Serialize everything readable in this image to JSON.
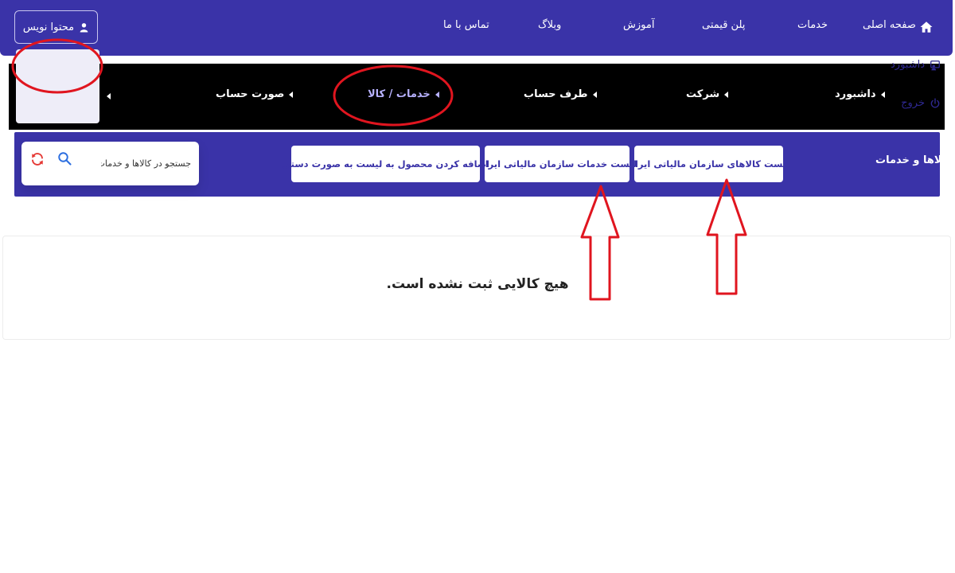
{
  "header": {
    "home_label": "صفحه اصلی",
    "nav": [
      "خدمات",
      "پلن قیمتی",
      "آموزش",
      "وبلاگ",
      "تماس با ما"
    ],
    "user_label": "محتوا نویس"
  },
  "user_menu": {
    "dashboard": "داشبورد",
    "logout": "خروج"
  },
  "tabs": [
    "داشبورد",
    "شرکت",
    "طرف حساب",
    "خدمات / کالا",
    "صورت حساب"
  ],
  "active_tab": "خدمات / کالا",
  "subbar": {
    "title": "کالاها و خدمات",
    "buttons": [
      "لیست کالاهای سازمان مالیاتی ایران",
      "لیست خدمات سازمان مالیاتی ایران",
      "اضافه کردن محصول به لیست به صورت دستی"
    ],
    "search_placeholder": "جستجو در کالاها و خدمات"
  },
  "empty_state": {
    "message": "هیچ کالایی ثبت نشده است."
  },
  "colors": {
    "primary": "#3a33a8",
    "tabbar": "#000000",
    "annotation": "#e0151f",
    "refresh": "#e53935",
    "search": "#2d6fe0"
  }
}
